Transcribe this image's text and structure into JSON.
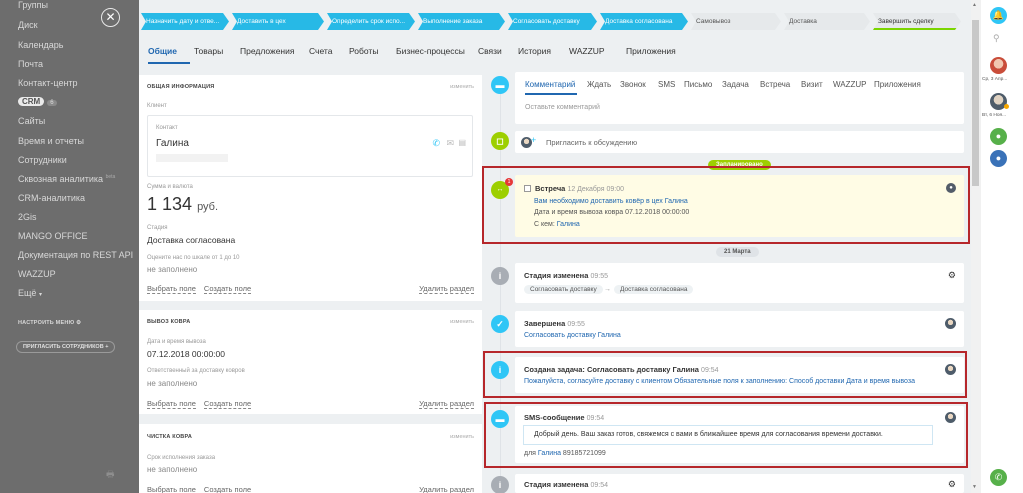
{
  "sidebar": {
    "items": [
      "Группы",
      "Диск",
      "Календарь",
      "Почта",
      "Контакт-центр",
      "CRM",
      "Сайты",
      "Время и отчеты",
      "Сотрудники",
      "Сквозная аналитика",
      "CRM-аналитика",
      "2Gis",
      "MANGO OFFICE",
      "Документация по REST API",
      "WAZZUP",
      "Ещё"
    ],
    "crm_count": "6",
    "beta_label": "beta",
    "more_arrow": "▾",
    "configure_menu": "НАСТРОИТЬ МЕНЮ",
    "invite": "ПРИГЛАСИТЬ СОТРУДНИКОВ",
    "close_glyph": "✕",
    "printer_glyph": "🖶"
  },
  "stages": [
    {
      "label": "Назначить дату и отве...",
      "state": "active"
    },
    {
      "label": "Доставить в цех",
      "state": "active"
    },
    {
      "label": "Определить срок испо...",
      "state": "active"
    },
    {
      "label": "Выполнение заказа",
      "state": "active"
    },
    {
      "label": "Согласовать доставку",
      "state": "active"
    },
    {
      "label": "Доставка согласована",
      "state": "active"
    },
    {
      "label": "Самовывоз",
      "state": "inactive"
    },
    {
      "label": "Доставка",
      "state": "inactive"
    },
    {
      "label": "Завершить сделку",
      "state": "finish"
    }
  ],
  "tabs": [
    "Общие",
    "Товары",
    "Предложения",
    "Счета",
    "Роботы",
    "Бизнес-процессы",
    "Связи",
    "История",
    "WAZZUP",
    "Приложения"
  ],
  "general": {
    "title": "ОБЩАЯ ИНФОРМАЦИЯ",
    "change": "изменить",
    "client_label": "Клиент",
    "contact_label": "Контакт",
    "contact_name": "Галина",
    "amount_label": "Сумма и валюта",
    "amount": "1 134",
    "currency": "руб.",
    "stage_label": "Стадия",
    "stage_value": "Доставка согласована",
    "rating_label": "Оцените нас по шкале от 1 до 10",
    "rating_value": "не заполнено",
    "select_field": "Выбрать поле",
    "create_field": "Создать поле",
    "delete_section": "Удалить раздел"
  },
  "pickup": {
    "title": "ВЫВОЗ КОВРА",
    "change": "изменить",
    "date_label": "Дата и время вывоза",
    "date_value": "07.12.2018 00:00:00",
    "resp_label": "Ответственный за доставку ковров",
    "resp_value": "не заполнено",
    "select_field": "Выбрать поле",
    "create_field": "Создать поле",
    "delete_section": "Удалить раздел"
  },
  "cleaning": {
    "title": "ЧИСТКА КОВРА",
    "change": "изменить",
    "term_label": "Срок исполнения заказа",
    "term_value": "не заполнено",
    "select_field": "Выбрать поле",
    "create_field": "Создать поле",
    "delete_section": "Удалить раздел"
  },
  "comment_tabs": [
    "Комментарий",
    "Ждать",
    "Звонок",
    "SMS",
    "Письмо",
    "Задача",
    "Встреча",
    "Визит",
    "WAZZUP",
    "Приложения"
  ],
  "comment_placeholder": "Оставьте комментарий",
  "invite_discussion": "Пригласить к обсуждению",
  "planned_pill": "Запланировано",
  "meeting": {
    "badge": "1",
    "title": "Встреча",
    "time": "12 Декабря 09:00",
    "link": "Вам необходимо доставить ковёр в цех Галина",
    "line2": "Дата и время вывоза ковра 07.12.2018 00:00:00",
    "with_label": "С кем:",
    "with_name": "Галина"
  },
  "date_pill": "21 Марта",
  "stage_change": {
    "title": "Стадия изменена",
    "time": "09:55",
    "from": "Согласовать доставку",
    "arrow": "→",
    "to": "Доставка согласована"
  },
  "done": {
    "title": "Завершена",
    "time": "09:55",
    "link": "Согласовать доставку Галина"
  },
  "task": {
    "title": "Создана задача: Согласовать доставку Галина",
    "time": "09:54",
    "text": "Пожалуйста, согласуйте доставку с клиентом Обязательные поля к заполнению: Способ доставки Дата и время вывоза"
  },
  "sms": {
    "title": "SMS-сообщение",
    "time": "09:54",
    "text": "Добрый день. Ваш заказ готов, свяжемся с вами в ближайшее время для согласования времени доставки.",
    "for_label": "для",
    "for_name": "Галина",
    "phone": "89185721099"
  },
  "stage_change2": {
    "title": "Стадия изменена",
    "time": "09:54"
  },
  "right_bar": {
    "user1": "Ср, 3 Апр...",
    "user2": "Вт, 6 Ноя..."
  },
  "colors": {
    "stage_active": "#27b9e6",
    "link": "#2067b0",
    "green": "#9dcf00",
    "highlight": "#b6272b"
  }
}
